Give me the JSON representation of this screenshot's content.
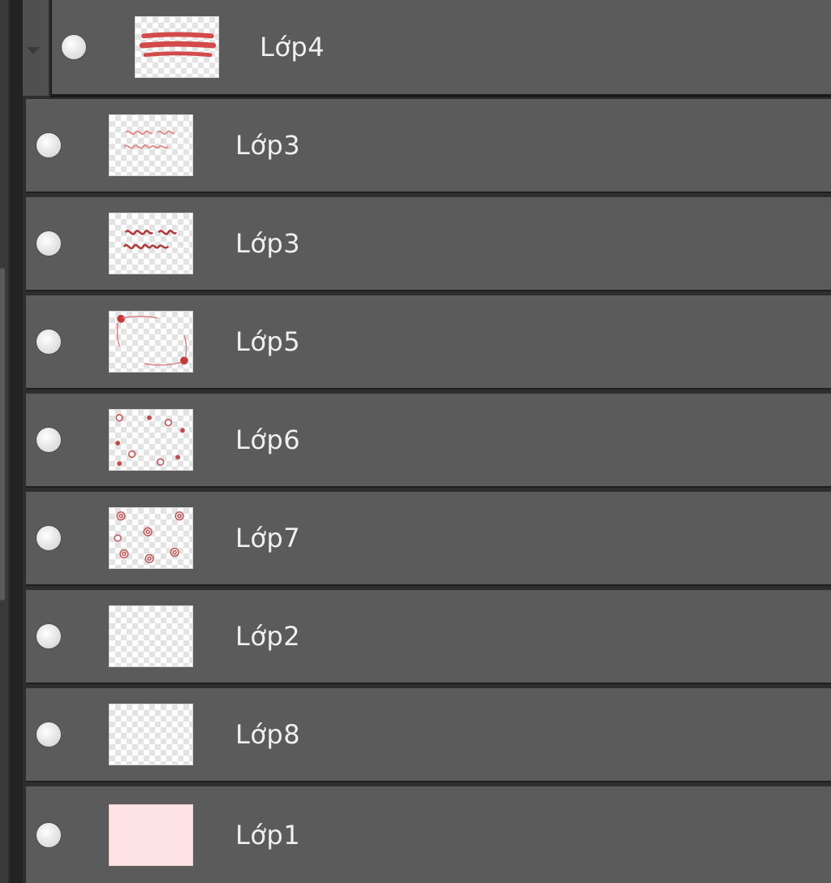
{
  "layers_panel": {
    "layers": [
      {
        "name": "Lớp4",
        "visible": true,
        "thumbnail": "red-brush-strokes"
      },
      {
        "name": "Lớp3",
        "visible": true,
        "thumbnail": "light-red-handwriting"
      },
      {
        "name": "Lớp3",
        "visible": true,
        "thumbnail": "dark-red-handwriting"
      },
      {
        "name": "Lớp5",
        "visible": true,
        "thumbnail": "corner-dots-frame"
      },
      {
        "name": "Lớp6",
        "visible": true,
        "thumbnail": "scattered-dots"
      },
      {
        "name": "Lớp7",
        "visible": true,
        "thumbnail": "scattered-flowers"
      },
      {
        "name": "Lớp2",
        "visible": true,
        "thumbnail": "empty-transparent"
      },
      {
        "name": "Lớp8",
        "visible": true,
        "thumbnail": "empty-transparent"
      },
      {
        "name": "Lớp1",
        "visible": true,
        "thumbnail": "solid-pink-fill"
      }
    ]
  },
  "colors": {
    "row_background": "#5b5b5b",
    "row_separator": "#1f1f1f",
    "label_text": "#f0f0f0",
    "thumbnail_accent": "#d24a4a",
    "background_fill": "#fde3e3"
  },
  "icons": {
    "visibility": "eye-icon",
    "group_toggle": "chevron-down-icon"
  }
}
